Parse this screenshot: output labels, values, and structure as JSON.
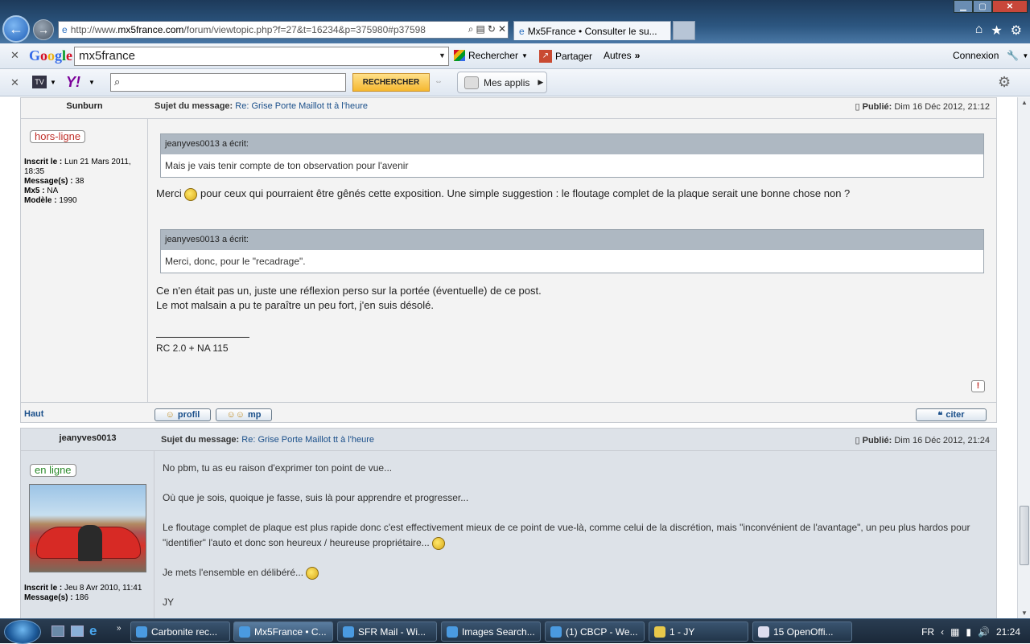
{
  "browser": {
    "url_prefix": "http://www.",
    "url_domain": "mx5france.com",
    "url_rest": "/forum/viewtopic.php?f=27&t=16234&p=375980#p37598",
    "tab_title": "Mx5France • Consulter le su...",
    "window_controls": {
      "minimize": "▁",
      "maximize": "▢",
      "close": "✕"
    },
    "cmd_icons": [
      "home-icon",
      "star-icon",
      "gear-icon"
    ]
  },
  "google_toolbar": {
    "logo": "Google",
    "search_value": "mx5france",
    "rechercher": "Rechercher",
    "partager": "Partager",
    "autres": "Autres",
    "autres_arrow": "»",
    "connexion": "Connexion"
  },
  "yahoo_toolbar": {
    "tv": "TV",
    "yahoo": "Y!",
    "search_button": "RECHERCHER",
    "mes_applis": "Mes applis"
  },
  "posts": [
    {
      "author": "Sunburn",
      "status": "hors-ligne",
      "inscrit_label": "Inscrit le :",
      "inscrit_value": "Lun 21 Mars 2011, 18:35",
      "messages_label": "Message(s) :",
      "messages_value": "38",
      "mx5_label": "Mx5 :",
      "mx5_value": "NA",
      "modele_label": "Modèle :",
      "modele_value": "1990",
      "subject_label": "Sujet du message:",
      "subject": "Re: Grise Porte Maillot tt à l'heure",
      "posted_label": "Publié:",
      "posted": "Dim 16 Déc 2012, 21:12",
      "quote1_head": "jeanyves0013 a écrit:",
      "quote1_body": "Mais je vais tenir compte de ton observation pour l'avenir",
      "line1_a": "Merci",
      "line1_b": "pour ceux qui pourraient être gênés cette exposition. Une simple suggestion : le floutage complet de la plaque serait une bonne chose non ?",
      "quote2_head": "jeanyves0013 a écrit:",
      "quote2_body": "Merci, donc, pour le \"recadrage\".",
      "line2": "Ce n'en était pas un, juste une réflexion perso sur la portée (éventuelle) de ce post.",
      "line3": "Le mot malsain a pu te paraître un peu fort, j'en suis désolé.",
      "signature": "RC 2.0 + NA 115",
      "report": "!",
      "haut": "Haut",
      "profil": "profil",
      "mp": "mp",
      "citer": "citer"
    },
    {
      "author": "jeanyves0013",
      "status": "en ligne",
      "inscrit_label": "Inscrit le :",
      "inscrit_value": "Jeu 8 Avr 2010, 11:41",
      "messages_label": "Message(s) :",
      "messages_value": "186",
      "subject_label": "Sujet du message:",
      "subject": "Re: Grise Porte Maillot tt à l'heure",
      "posted_label": "Publié:",
      "posted": "Dim 16 Déc 2012, 21:24",
      "p1": "No pbm, tu as eu raison d'exprimer ton point de vue...",
      "p2": "Où que je sois, quoique je fasse, suis là pour apprendre et progresser...",
      "p3": "Le floutage complet de plaque est plus rapide donc c'est effectivement mieux de ce point de vue-là, comme celui de la discrétion, mais \"inconvénient de l'avantage\", un peu plus hardos pour \"identifier\" l'auto et donc son heureux / heureuse propriétaire...",
      "p4": "Je mets l'ensemble en délibéré...",
      "p5": "JY"
    }
  ],
  "taskbar": {
    "items": [
      {
        "label": "Carbonite rec...",
        "active": false
      },
      {
        "label": "Mx5France • C...",
        "active": true
      },
      {
        "label": "SFR Mail - Wi...",
        "active": false
      },
      {
        "label": "Images Search...",
        "active": false
      },
      {
        "label": "(1) CBCP - We...",
        "active": false
      },
      {
        "label": "1 - JY",
        "active": false
      },
      {
        "label": "15 OpenOffi...",
        "active": false
      }
    ],
    "lang": "FR",
    "clock": "21:24"
  }
}
